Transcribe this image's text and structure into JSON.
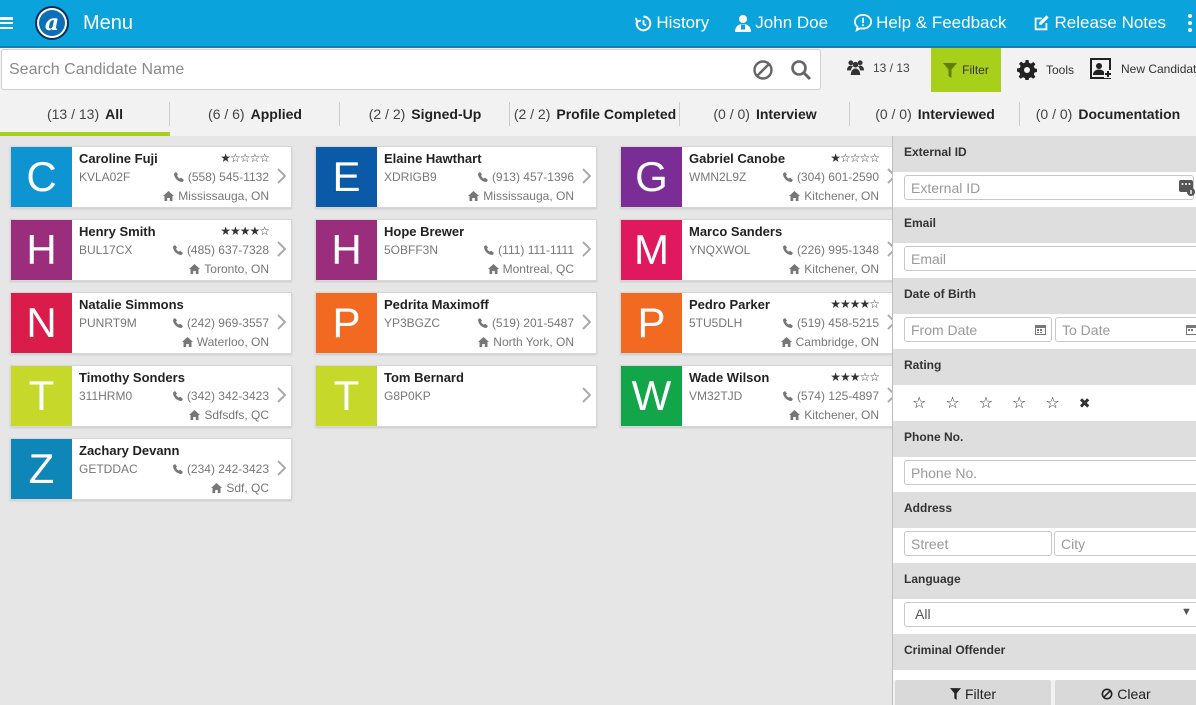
{
  "header": {
    "menu_label": "Menu",
    "nav": [
      {
        "label": "History",
        "icon": "history-icon"
      },
      {
        "label": "John Doe",
        "icon": "user-icon"
      },
      {
        "label": "Help & Feedback",
        "icon": "help-icon"
      },
      {
        "label": "Release Notes",
        "icon": "edit-icon"
      }
    ]
  },
  "search": {
    "placeholder": "Search Candidate Name",
    "value": ""
  },
  "toolbar": {
    "count": "13 / 13",
    "filter_label": "Filter",
    "tools_label": "Tools",
    "new_candidate_label": "New Candidate"
  },
  "tabs": [
    {
      "count": "(13 / 13)",
      "label": "All",
      "active": true
    },
    {
      "count": "(6 / 6)",
      "label": "Applied"
    },
    {
      "count": "(2 / 2)",
      "label": "Signed-Up"
    },
    {
      "count": "(2 / 2)",
      "label": "Profile Completed"
    },
    {
      "count": "(0 / 0)",
      "label": "Interview"
    },
    {
      "count": "(0 / 0)",
      "label": "Interviewed"
    },
    {
      "count": "(0 / 0)",
      "label": "Documentation"
    }
  ],
  "candidates": [
    {
      "letter": "C",
      "name": "Caroline Fuji",
      "code": "KVLA02F",
      "phone": "(558) 545-1132",
      "location": "Mississauga, ON",
      "rating": 1,
      "color": "#0e95d1"
    },
    {
      "letter": "E",
      "name": "Elaine Hawthart",
      "code": "XDRIGB9",
      "phone": "(913) 457-1396",
      "location": "Mississauga, ON",
      "rating": 0,
      "color": "#0b5aa8"
    },
    {
      "letter": "G",
      "name": "Gabriel Canobe",
      "code": "WMN2L9Z",
      "phone": "(304) 601-2590",
      "location": "Kitchener, ON",
      "rating": 1,
      "color": "#7a2d94"
    },
    {
      "letter": "H",
      "name": "Henry Smith",
      "code": "BUL17CX",
      "phone": "(485) 637-7328",
      "location": "Toronto, ON",
      "rating": 4,
      "color": "#9b2d7d"
    },
    {
      "letter": "H",
      "name": "Hope Brewer",
      "code": "5OBFF3N",
      "phone": "(111) 111-1111",
      "location": "Montreal, QC",
      "rating": 0,
      "color": "#9b2d7d"
    },
    {
      "letter": "M",
      "name": "Marco Sanders",
      "code": "YNQXWOL",
      "phone": "(226) 995-1348",
      "location": "Kitchener, ON",
      "rating": 0,
      "color": "#e0185e"
    },
    {
      "letter": "N",
      "name": "Natalie Simmons",
      "code": "PUNRT9M",
      "phone": "(242) 969-3557",
      "location": "Waterloo, ON",
      "rating": 0,
      "color": "#d91c4a"
    },
    {
      "letter": "P",
      "name": "Pedrita Maximoff",
      "code": "YP3BGZC",
      "phone": "(519) 201-5487",
      "location": "North York, ON",
      "rating": 0,
      "color": "#f26a21"
    },
    {
      "letter": "P",
      "name": "Pedro Parker",
      "code": "5TU5DLH",
      "phone": "(519) 458-5215",
      "location": "Cambridge, ON",
      "rating": 4,
      "color": "#f26a21"
    },
    {
      "letter": "T",
      "name": "Timothy Sonders",
      "code": "311HRM0",
      "phone": "(342) 342-3423",
      "location": "Sdfsdfs, QC",
      "rating": 0,
      "color": "#c6d92b"
    },
    {
      "letter": "T",
      "name": "Tom Bernard",
      "code": "G8P0KP",
      "phone": "",
      "location": "",
      "rating": 0,
      "color": "#c6d92b"
    },
    {
      "letter": "W",
      "name": "Wade Wilson",
      "code": "VM32TJD",
      "phone": "(574) 125-4897",
      "location": "Kitchener, ON",
      "rating": 3,
      "color": "#13a54a"
    },
    {
      "letter": "Z",
      "name": "Zachary Devann",
      "code": "GETDDAC",
      "phone": "(234) 242-3423",
      "location": "Sdf, QC",
      "rating": 0,
      "color": "#0e86b8"
    }
  ],
  "filters": {
    "external_id": {
      "label": "External ID",
      "placeholder": "External ID"
    },
    "email": {
      "label": "Email",
      "placeholder": "Email"
    },
    "dob": {
      "label": "Date of Birth",
      "from_placeholder": "From Date",
      "to_placeholder": "To Date"
    },
    "rating": {
      "label": "Rating"
    },
    "phone": {
      "label": "Phone No.",
      "placeholder": "Phone No."
    },
    "address": {
      "label": "Address",
      "street_placeholder": "Street",
      "city_placeholder": "City"
    },
    "language": {
      "label": "Language",
      "selected": "All"
    },
    "criminal": {
      "label": "Criminal Offender"
    },
    "filter_button": "Filter",
    "clear_button": "Clear"
  },
  "colors": {
    "topbar": "#0aa3dc",
    "accent_green": "#a8cf1a"
  }
}
